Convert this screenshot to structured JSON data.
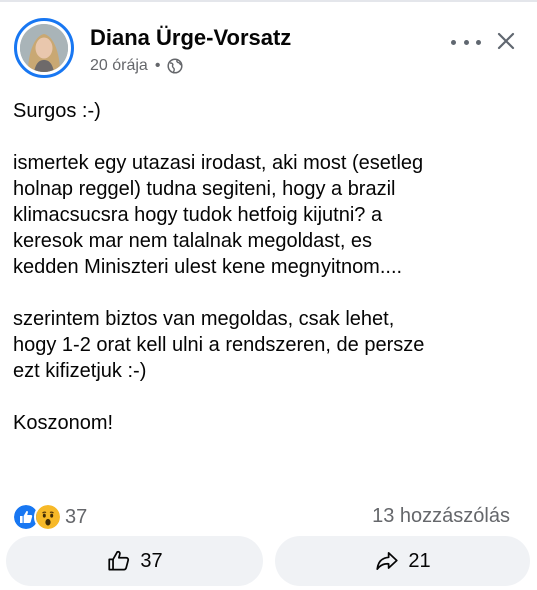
{
  "post": {
    "author": "Diana Ürge-Vorsatz",
    "time": "20 órája",
    "separator": "•",
    "audience_icon": "globe-icon",
    "paragraphs": [
      "Surgos :-)",
      "ismertek egy utazasi irodast, aki most (esetleg\nholnap reggel) tudna segiteni, hogy a brazil\nklimacsucsra hogy tudok hetfoig kijutni?  a\nkeresok mar nem talalnak megoldast, es\nkedden Miniszteri ulest kene megnyitnom....",
      "szerintem biztos van megoldas, csak lehet,\nhogy 1-2 orat kell ulni a rendszeren, de persze\nezt kifizetjuk :-)",
      "Koszonom!"
    ]
  },
  "stats": {
    "reactions_count": "37",
    "reaction_icons": [
      "like-reaction-icon",
      "wow-reaction-icon"
    ],
    "comments_label": "13 hozzászólás"
  },
  "actions": {
    "like_count": "37",
    "share_count": "21"
  },
  "colors": {
    "accent": "#1877f2",
    "secondary_text": "#65676b",
    "button_bg": "#f0f2f5",
    "wow_yellow": "#f7b928"
  }
}
